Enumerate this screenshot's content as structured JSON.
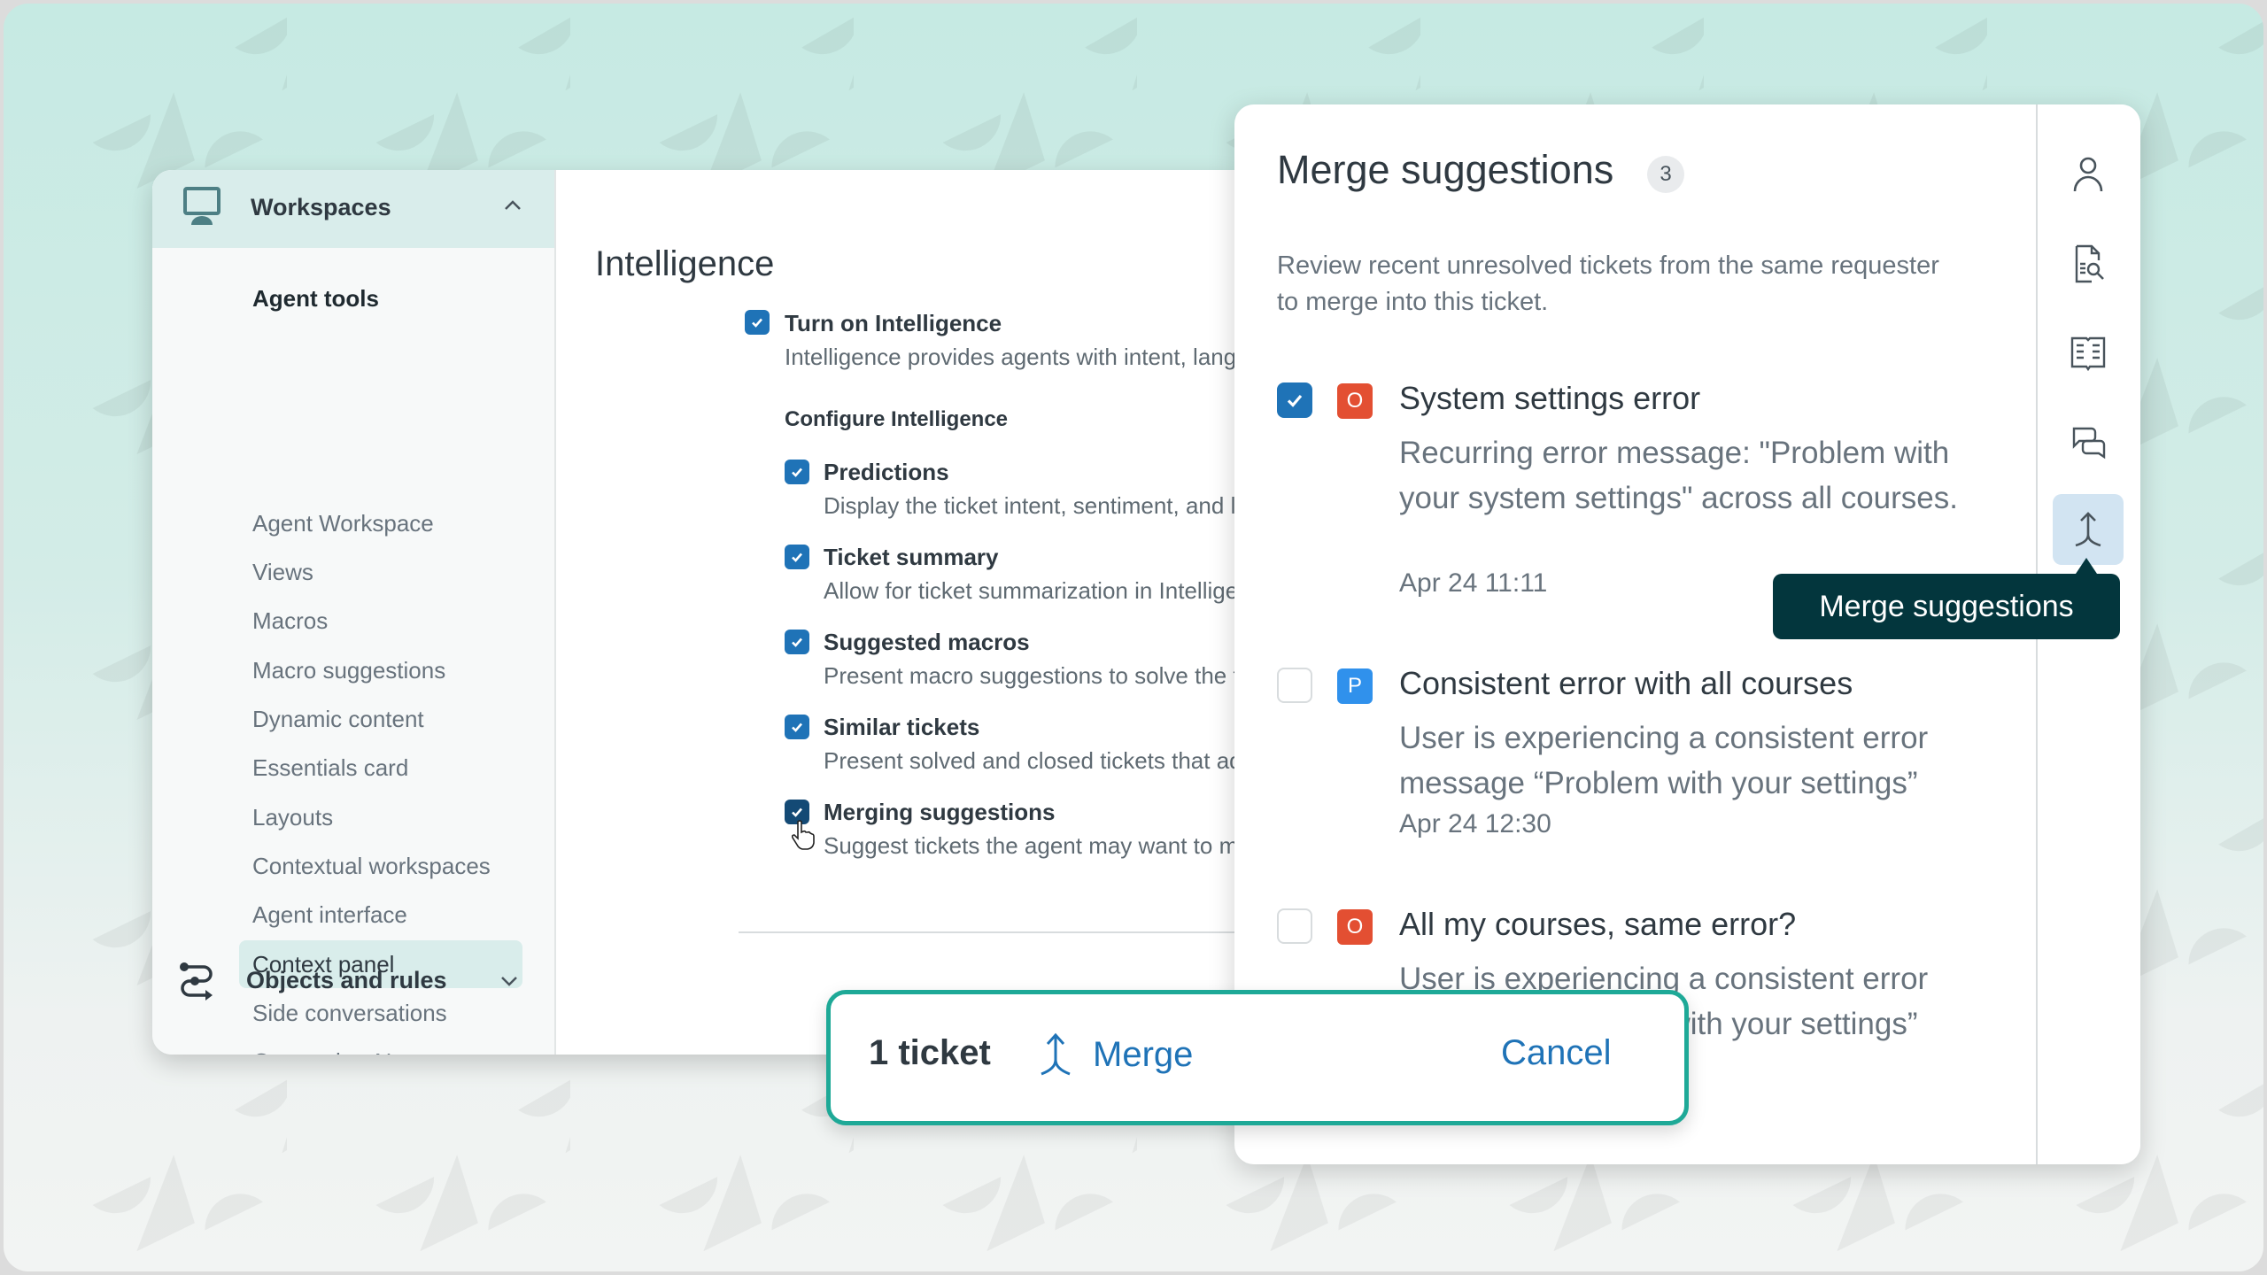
{
  "colors": {
    "accent_blue": "#1f73b7",
    "teal_border": "#1ea997",
    "tooltip_bg": "#03363d",
    "status_open": "#e34f32",
    "status_pending": "#3091ec",
    "nav_highlight": "#d9edeb"
  },
  "nav": {
    "section_label": "Workspaces",
    "section_icon": "monitor-icon",
    "section_expanded": true,
    "group_title": "Agent tools",
    "items": [
      {
        "label": "Agent Workspace",
        "active": false
      },
      {
        "label": "Views",
        "active": false
      },
      {
        "label": "Macros",
        "active": false
      },
      {
        "label": "Macro suggestions",
        "active": false
      },
      {
        "label": "Dynamic content",
        "active": false
      },
      {
        "label": "Essentials card",
        "active": false
      },
      {
        "label": "Layouts",
        "active": false
      },
      {
        "label": "Contextual workspaces",
        "active": false
      },
      {
        "label": "Agent interface",
        "active": false
      },
      {
        "label": "Context panel",
        "active": true
      },
      {
        "label": "Side conversations",
        "active": false
      },
      {
        "label": "Generative AI",
        "active": false
      }
    ],
    "footer_section": {
      "label": "Objects and rules",
      "icon": "objects-rules-icon",
      "expanded": false
    }
  },
  "settings": {
    "title": "Intelligence",
    "main_option": {
      "label": "Turn on Intelligence",
      "description": "Intelligence provides agents with intent, language, sentim",
      "checked": true
    },
    "config_title": "Configure Intelligence",
    "options": [
      {
        "label": "Predictions",
        "description": "Display the ticket intent, sentiment, and language",
        "checked": true
      },
      {
        "label": "Ticket summary",
        "description": "Allow for ticket summarization in Intelligence",
        "checked": true
      },
      {
        "label": "Suggested macros",
        "description": "Present macro suggestions to solve the ticket",
        "checked": true
      },
      {
        "label": "Similar tickets",
        "description": "Present solved and closed tickets that addressed sim",
        "checked": true
      },
      {
        "label": "Merging suggestions",
        "description": "Suggest tickets the agent may want to merge with the",
        "checked": true
      }
    ]
  },
  "panel": {
    "title": "Merge suggestions",
    "count": "3",
    "description": "Review recent unresolved tickets from the same requester to merge into this ticket.",
    "suggestions": [
      {
        "status_letter": "O",
        "status": "open",
        "title": "System settings error",
        "body": "Recurring error message: \"Problem with your system settings\" across all courses.",
        "date": "Apr 24 11:11",
        "checked": true
      },
      {
        "status_letter": "P",
        "status": "pending",
        "title": "Consistent error with all courses",
        "body": "User is experiencing a consistent error message “Problem with your settings”",
        "date": "Apr 24 12:30",
        "checked": false
      },
      {
        "status_letter": "O",
        "status": "open",
        "title": "All my courses, same error?",
        "body": "User is experiencing a consistent error message “Problem with your settings”",
        "date": "",
        "checked": false
      }
    ],
    "rail_icons": [
      "user-icon",
      "knowledge-search-icon",
      "book-icon",
      "side-conversations-icon",
      "merge-icon"
    ],
    "active_rail_icon": "merge-icon",
    "tooltip": "Merge suggestions"
  },
  "merge_bar": {
    "count_label": "1 ticket",
    "merge_label": "Merge",
    "cancel_label": "Cancel"
  }
}
